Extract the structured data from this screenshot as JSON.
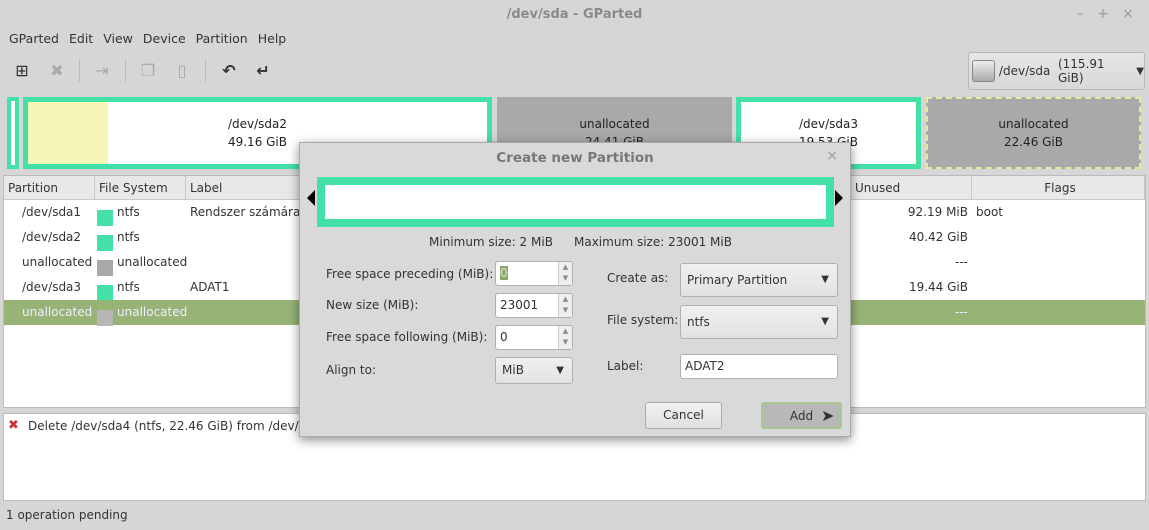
{
  "window": {
    "title": "/dev/sda - GParted",
    "controls": [
      "–",
      "+",
      "×"
    ]
  },
  "menu": [
    "GParted",
    "Edit",
    "View",
    "Device",
    "Partition",
    "Help"
  ],
  "toolbar": {
    "icons": [
      "new-partition-icon",
      "delete-icon",
      "resize-icon",
      "copy-icon",
      "paste-icon",
      "undo-icon",
      "apply-icon"
    ]
  },
  "device": {
    "name": "/dev/sda",
    "size": "(115.91 GiB)"
  },
  "map": [
    {
      "name": "/dev/sda2",
      "size": "49.16 GiB"
    },
    {
      "name": "unallocated",
      "size": "24.41 GiB"
    },
    {
      "name": "/dev/sda3",
      "size": "19.53 GiB"
    },
    {
      "name": "unallocated",
      "size": "22.46 GiB"
    }
  ],
  "table": {
    "headers": [
      "Partition",
      "File System",
      "Label",
      "Unused",
      "Flags"
    ],
    "rows": [
      {
        "partition": "/dev/sda1",
        "fs": "ntfs",
        "label": "Rendszer számára",
        "unused": "92.19 MiB",
        "flags": "boot",
        "color": "#43e0a8"
      },
      {
        "partition": "/dev/sda2",
        "fs": "ntfs",
        "label": "",
        "unused": "40.42 GiB",
        "flags": "",
        "color": "#43e0a8"
      },
      {
        "partition": "unallocated",
        "fs": "unallocated",
        "label": "",
        "unused": "---",
        "flags": "",
        "color": "#a9a9a9"
      },
      {
        "partition": "/dev/sda3",
        "fs": "ntfs",
        "label": "ADAT1",
        "unused": "19.44 GiB",
        "flags": "",
        "color": "#43e0a8"
      },
      {
        "partition": "unallocated",
        "fs": "unallocated",
        "label": "",
        "unused": "---",
        "flags": "",
        "color": "#a9a9a9"
      }
    ]
  },
  "log": {
    "entry": "Delete /dev/sda4 (ntfs, 22.46 GiB) from /dev/sda"
  },
  "status": "1 operation pending",
  "dialog": {
    "title": "Create new Partition",
    "close": "×",
    "min_size": "Minimum size: 2 MiB",
    "max_size": "Maximum size: 23001 MiB",
    "preceding_label": "Free space preceding (MiB):",
    "preceding": "0",
    "newsize_label": "New size (MiB):",
    "newsize": "23001",
    "following_label": "Free space following (MiB):",
    "following": "0",
    "align_label": "Align to:",
    "align": "MiB",
    "createas_label": "Create as:",
    "createas": "Primary Partition",
    "fs_label": "File system:",
    "fs": "ntfs",
    "label_label": "Label:",
    "label": "ADAT2",
    "cancel": "Cancel",
    "add": "Add"
  }
}
